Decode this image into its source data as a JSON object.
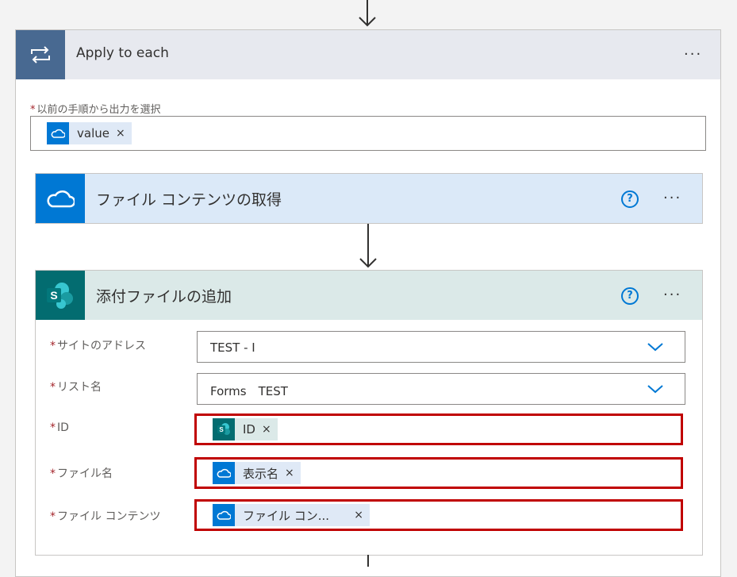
{
  "apply_each": {
    "title": "Apply to each",
    "more": "···",
    "select_label": "以前の手順から出力を選択",
    "required": "*",
    "token": {
      "label": "value",
      "remove": "×",
      "icon": "onedrive-cloud-icon"
    }
  },
  "get_content": {
    "title": "ファイル コンテンツの取得",
    "help": "?",
    "more": "···",
    "icon": "onedrive-cloud-icon"
  },
  "add_attachment": {
    "title": "添付ファイルの追加",
    "help": "?",
    "more": "···",
    "icon": "sharepoint-icon",
    "fields": {
      "site": {
        "label": "サイトのアドレス",
        "value": "TEST - I"
      },
      "list": {
        "label": "リスト名",
        "value": "Forms　TEST"
      },
      "id": {
        "label": "ID",
        "token": "ID",
        "remove": "×"
      },
      "filename": {
        "label": "ファイル名",
        "token": "表示名",
        "remove": "×"
      },
      "content": {
        "label": "ファイル コンテンツ",
        "token": "ファイル コン...",
        "remove": "×"
      }
    },
    "required": "*"
  },
  "colors": {
    "outer_header": "#e7e9ef",
    "outer_icon": "#486991",
    "onedrive_blue": "#0078d4",
    "onedrive_header": "#dbe9f8",
    "sharepoint_teal": "#036c70",
    "sharepoint_header": "#dbe9e8",
    "highlight_red": "#c00000"
  }
}
